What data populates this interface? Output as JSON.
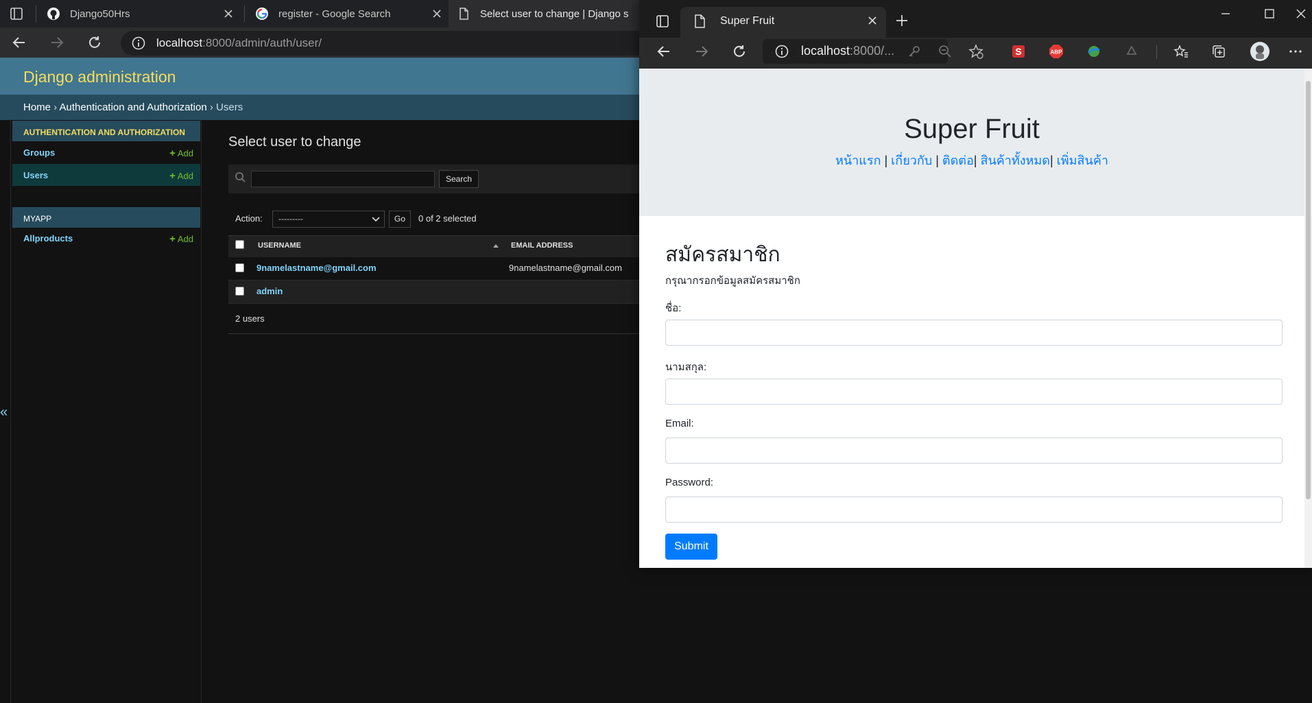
{
  "back_window": {
    "tabs": [
      {
        "title": "Django50Hrs",
        "icon": "github-icon"
      },
      {
        "title": "register - Google Search",
        "icon": "google-icon"
      },
      {
        "title": "Select user to change | Django s",
        "icon": "page-icon"
      }
    ],
    "url": {
      "host": "localhost",
      "path": ":8000/admin/auth/user/"
    },
    "admin": {
      "brand": "Django administration",
      "breadcrumb": {
        "home": "Home",
        "sep1": " › ",
        "section": "Authentication and Authorization",
        "sep2": " › ",
        "current": "Users"
      },
      "sidebar": {
        "sections": [
          {
            "caption": "AUTHENTICATION AND AUTHORIZATION",
            "items": [
              {
                "label": "Groups",
                "add": "Add"
              },
              {
                "label": "Users",
                "add": "Add"
              }
            ]
          },
          {
            "caption": "MYAPP",
            "items": [
              {
                "label": "Allproducts",
                "add": "Add"
              }
            ]
          }
        ],
        "collapse_glyph": "«"
      },
      "content": {
        "title": "Select user to change",
        "search_button": "Search",
        "action_label": "Action:",
        "action_selected": "---------",
        "go_button": "Go",
        "selection_count": "0 of 2 selected",
        "columns": [
          "USERNAME",
          "EMAIL ADDRESS"
        ],
        "rows": [
          {
            "username": "9namelastname@gmail.com",
            "email": "9namelastname@gmail.com"
          },
          {
            "username": "admin",
            "email": ""
          }
        ],
        "paginator": "2 users"
      }
    }
  },
  "front_window": {
    "tab_title": "Super Fruit",
    "url": {
      "host": "localhost",
      "path": ":8000/..."
    },
    "page": {
      "title": "Super Fruit",
      "nav": [
        {
          "label": "หน้าแรก",
          "sep": " | "
        },
        {
          "label": "เกี่ยวกับ",
          "sep": " | "
        },
        {
          "label": "ติดต่อ",
          "sep": "| "
        },
        {
          "label": "สินค้าทั้งหมด",
          "sep": "| "
        },
        {
          "label": "เพิ่มสินค้า",
          "sep": ""
        }
      ],
      "form": {
        "heading": "สมัครสมาชิก",
        "subtitle": "กรุณากรอกข้อมูลสมัครสมาชิก",
        "fields": [
          {
            "label": "ชื่อ:",
            "value": ""
          },
          {
            "label": "นามสกุล:",
            "value": ""
          },
          {
            "label": "Email:",
            "value": ""
          },
          {
            "label": "Password:",
            "value": ""
          }
        ],
        "submit": "Submit"
      }
    }
  },
  "colors": {
    "django_header": "#417690",
    "django_brand": "#f5dd5d",
    "django_link": "#81d4fa",
    "add_green": "#70bf2b",
    "bootstrap_primary": "#007bff",
    "jumbotron": "#e9ecef"
  }
}
